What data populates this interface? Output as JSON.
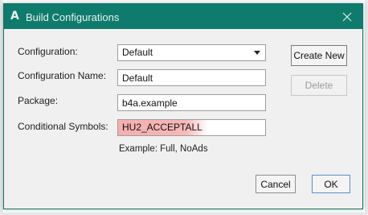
{
  "window": {
    "app_logo": "A",
    "title": "Build Configurations",
    "close_icon": "close-icon"
  },
  "form": {
    "configuration_label": "Configuration:",
    "configuration_value": "Default",
    "configuration_name_label": "Configuration Name:",
    "configuration_name_value": "Default",
    "package_label": "Package:",
    "package_value": "b4a.example",
    "symbols_label": "Conditional Symbols:",
    "symbols_value": "HU2_ACCEPTALL",
    "symbols_hint": "Example: Full, NoAds"
  },
  "buttons": {
    "create_new": "Create New",
    "delete": "Delete",
    "cancel": "Cancel",
    "ok": "OK"
  },
  "colors": {
    "titlebar": "#0f7b6c",
    "highlight": "#f4a0a0",
    "dialog_bg": "#f0f0f0",
    "ok_border": "#5a8fc8"
  }
}
